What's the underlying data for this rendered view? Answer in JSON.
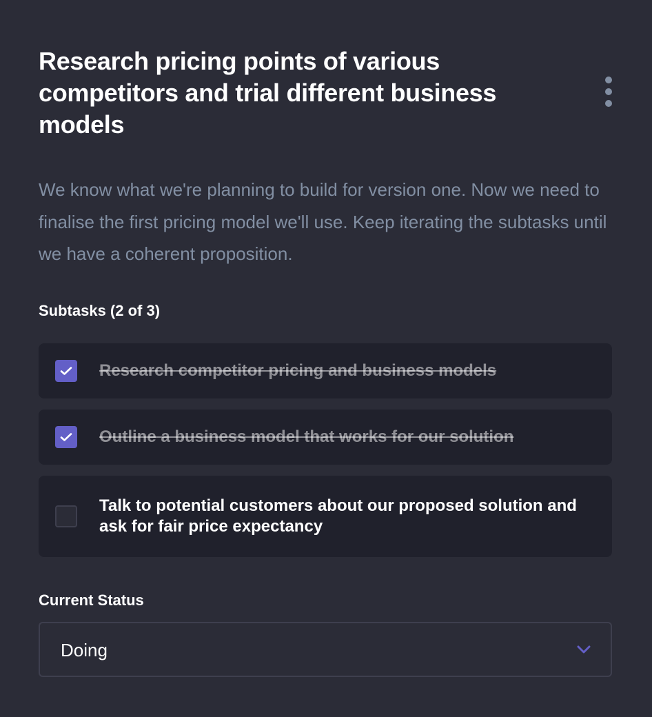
{
  "task": {
    "title": "Research pricing points of various competitors and trial different business models",
    "description": "We know what we're planning to build for version one. Now we need to finalise the first pricing model we'll use. Keep iterating the subtasks until we have a coherent proposition.",
    "more_icon": "vertical-ellipsis-icon"
  },
  "subtasks": {
    "heading": "Subtasks (2 of 3)",
    "items": [
      {
        "label": "Research competitor pricing and business models",
        "completed": true
      },
      {
        "label": "Outline a business model that works for our solution",
        "completed": true
      },
      {
        "label": "Talk to potential customers about our proposed solution and ask for fair price expectancy",
        "completed": false
      }
    ]
  },
  "status": {
    "heading": "Current Status",
    "selected": "Doing",
    "chevron_icon": "chevron-down-icon"
  },
  "colors": {
    "background": "#2b2c37",
    "subtask_background": "#20212c",
    "accent": "#635fc7",
    "muted_text": "#828fa3",
    "border": "#3e3f4e"
  }
}
